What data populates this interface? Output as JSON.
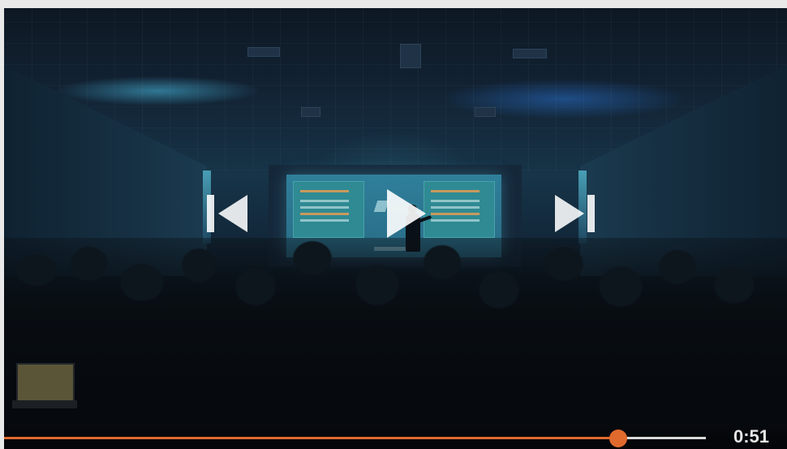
{
  "player": {
    "time_display": "0:51",
    "progress": 0.875,
    "colors": {
      "accent": "#e06a2e",
      "icon": "#ffffff",
      "track": "#ffffff"
    },
    "icons": {
      "previous": "skip-previous-icon",
      "play": "play-icon",
      "next": "skip-next-icon"
    }
  }
}
